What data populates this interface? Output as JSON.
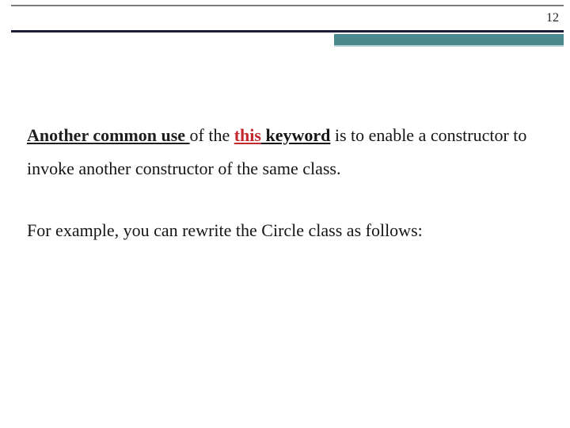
{
  "page_number": "12",
  "paragraphs": {
    "p1": {
      "lead": "Another common use ",
      "mid1": "of the ",
      "keyword": "this",
      "keyword_rest": " keyword",
      "tail": " is to enable a constructor to invoke another constructor of the same class."
    },
    "p2": "For example, you can rewrite the Circle class as follows:"
  }
}
